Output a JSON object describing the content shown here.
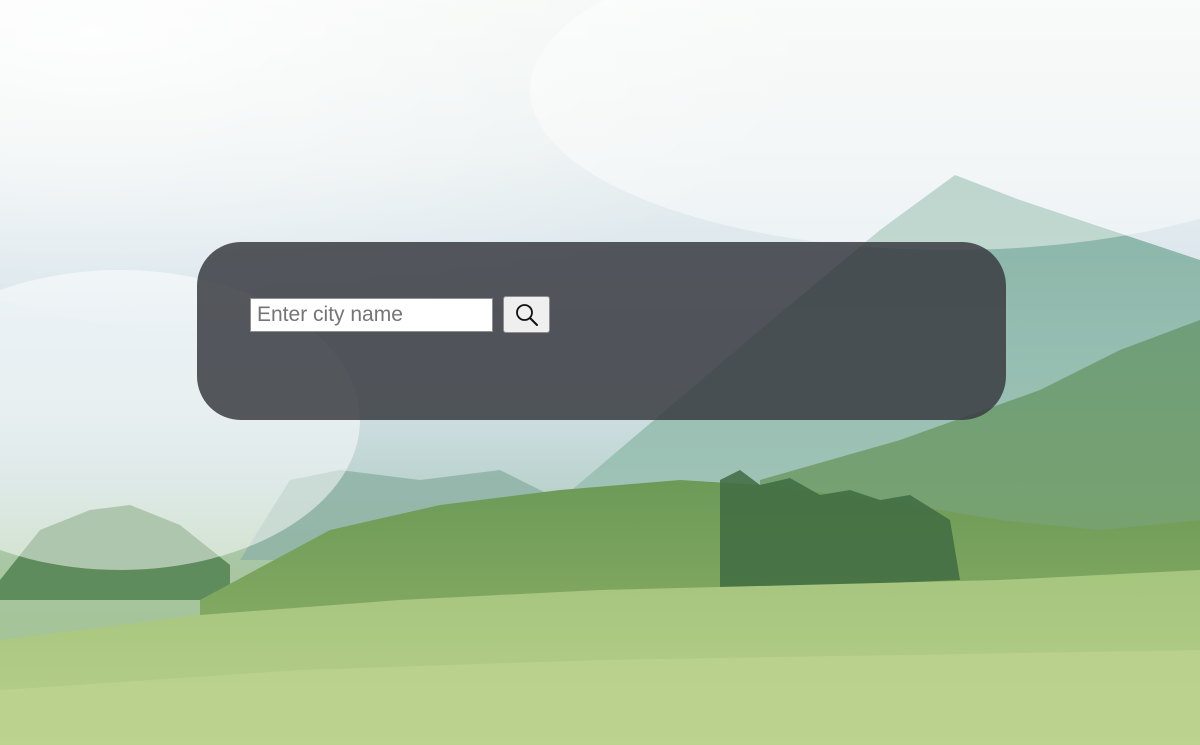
{
  "search": {
    "placeholder": "Enter city name",
    "value": "",
    "button_icon": "search-icon"
  },
  "colors": {
    "panel": "#3a3c42",
    "input_bg": "#ffffff",
    "button_bg": "#efefef"
  }
}
